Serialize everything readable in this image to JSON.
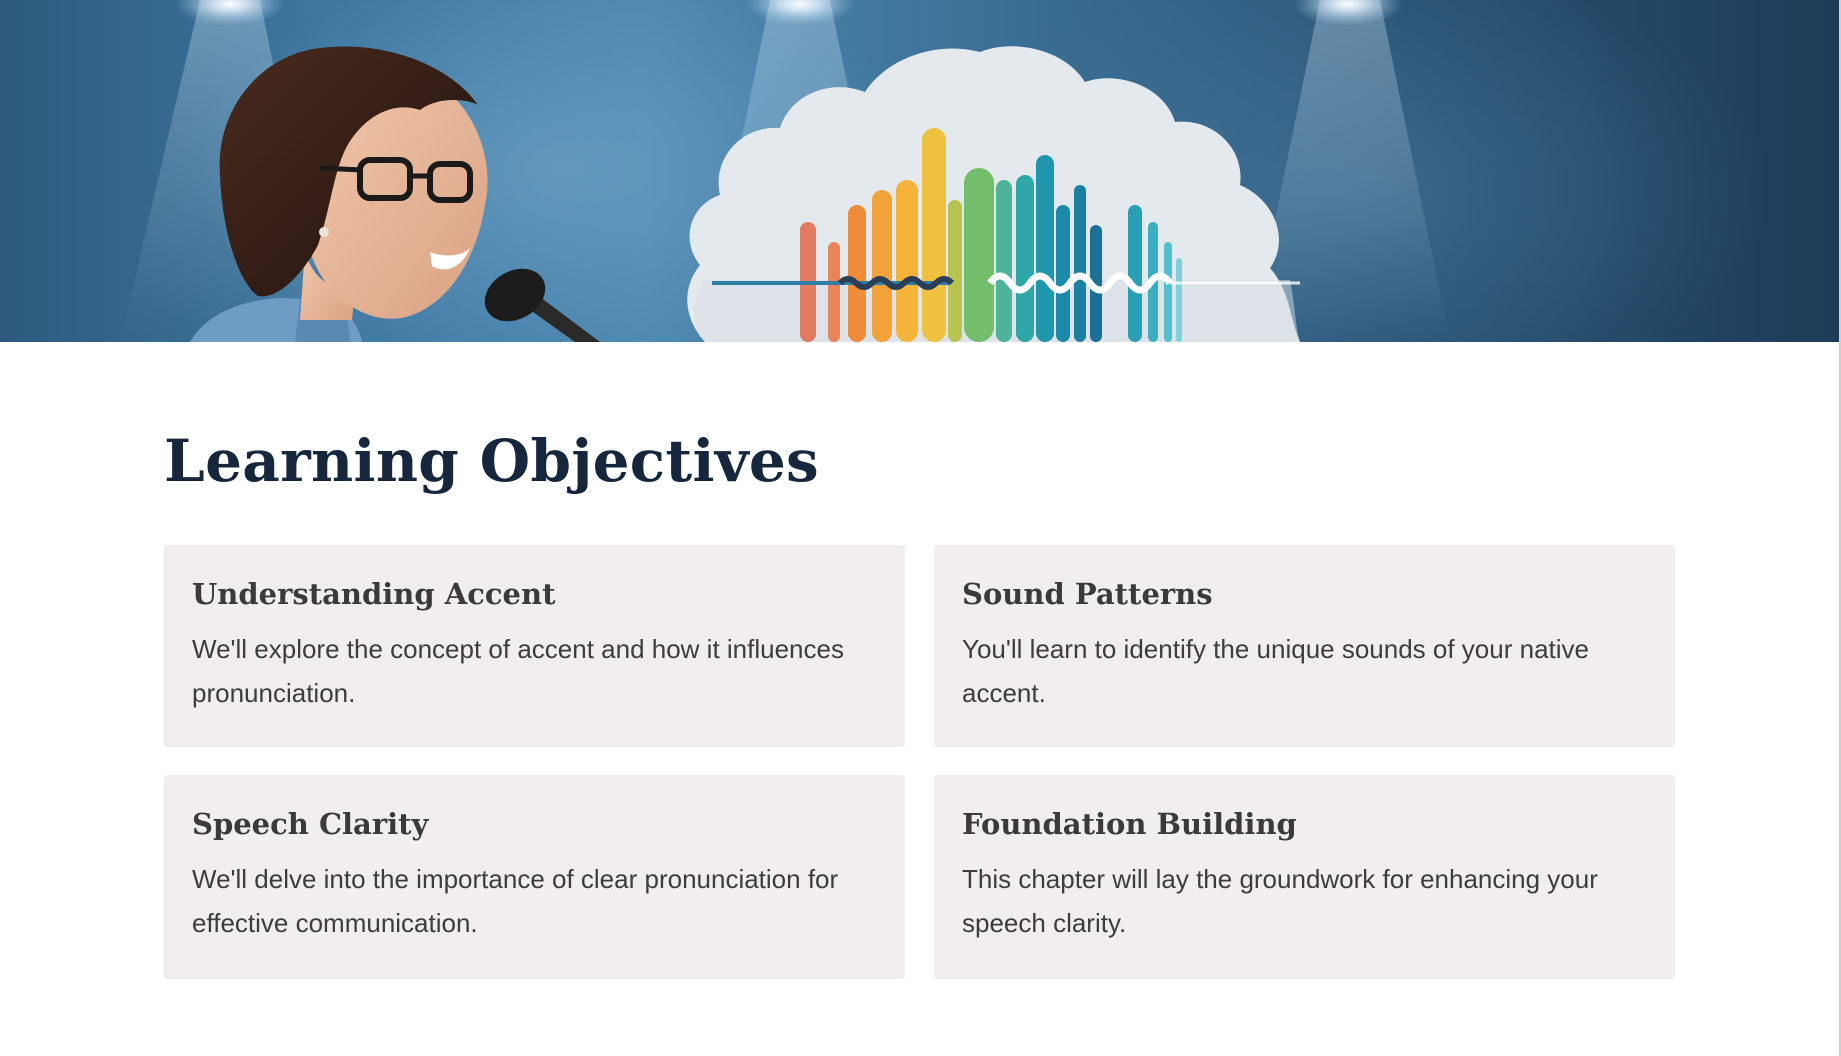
{
  "page": {
    "title": "Learning Objectives"
  },
  "banner": {
    "image": "speaker-with-microphone-and-colorful-soundwave-cloud",
    "colors": {
      "background": "#3e77a0",
      "cloud": "#e4e9ed",
      "wave_warm": [
        "#e06a55",
        "#f08a3a",
        "#f3b33a",
        "#e8c23a"
      ],
      "wave_cool": [
        "#6cb86a",
        "#2fa7a8",
        "#1a8aa8",
        "#1c6f95"
      ]
    }
  },
  "objectives": [
    {
      "title": "Understanding Accent",
      "text": "We'll explore the concept of accent and how it influences pronunciation."
    },
    {
      "title": "Sound Patterns",
      "text": "You'll learn to identify the unique sounds of your native accent."
    },
    {
      "title": "Speech Clarity",
      "text": "We'll delve into the importance of clear pronunciation for effective communication."
    },
    {
      "title": "Foundation Building",
      "text": "This chapter will lay the groundwork for enhancing your speech clarity."
    }
  ],
  "theme": {
    "heading_color": "#15263d",
    "card_background": "#f1eeed",
    "card_text_color": "#3d3d3d"
  }
}
